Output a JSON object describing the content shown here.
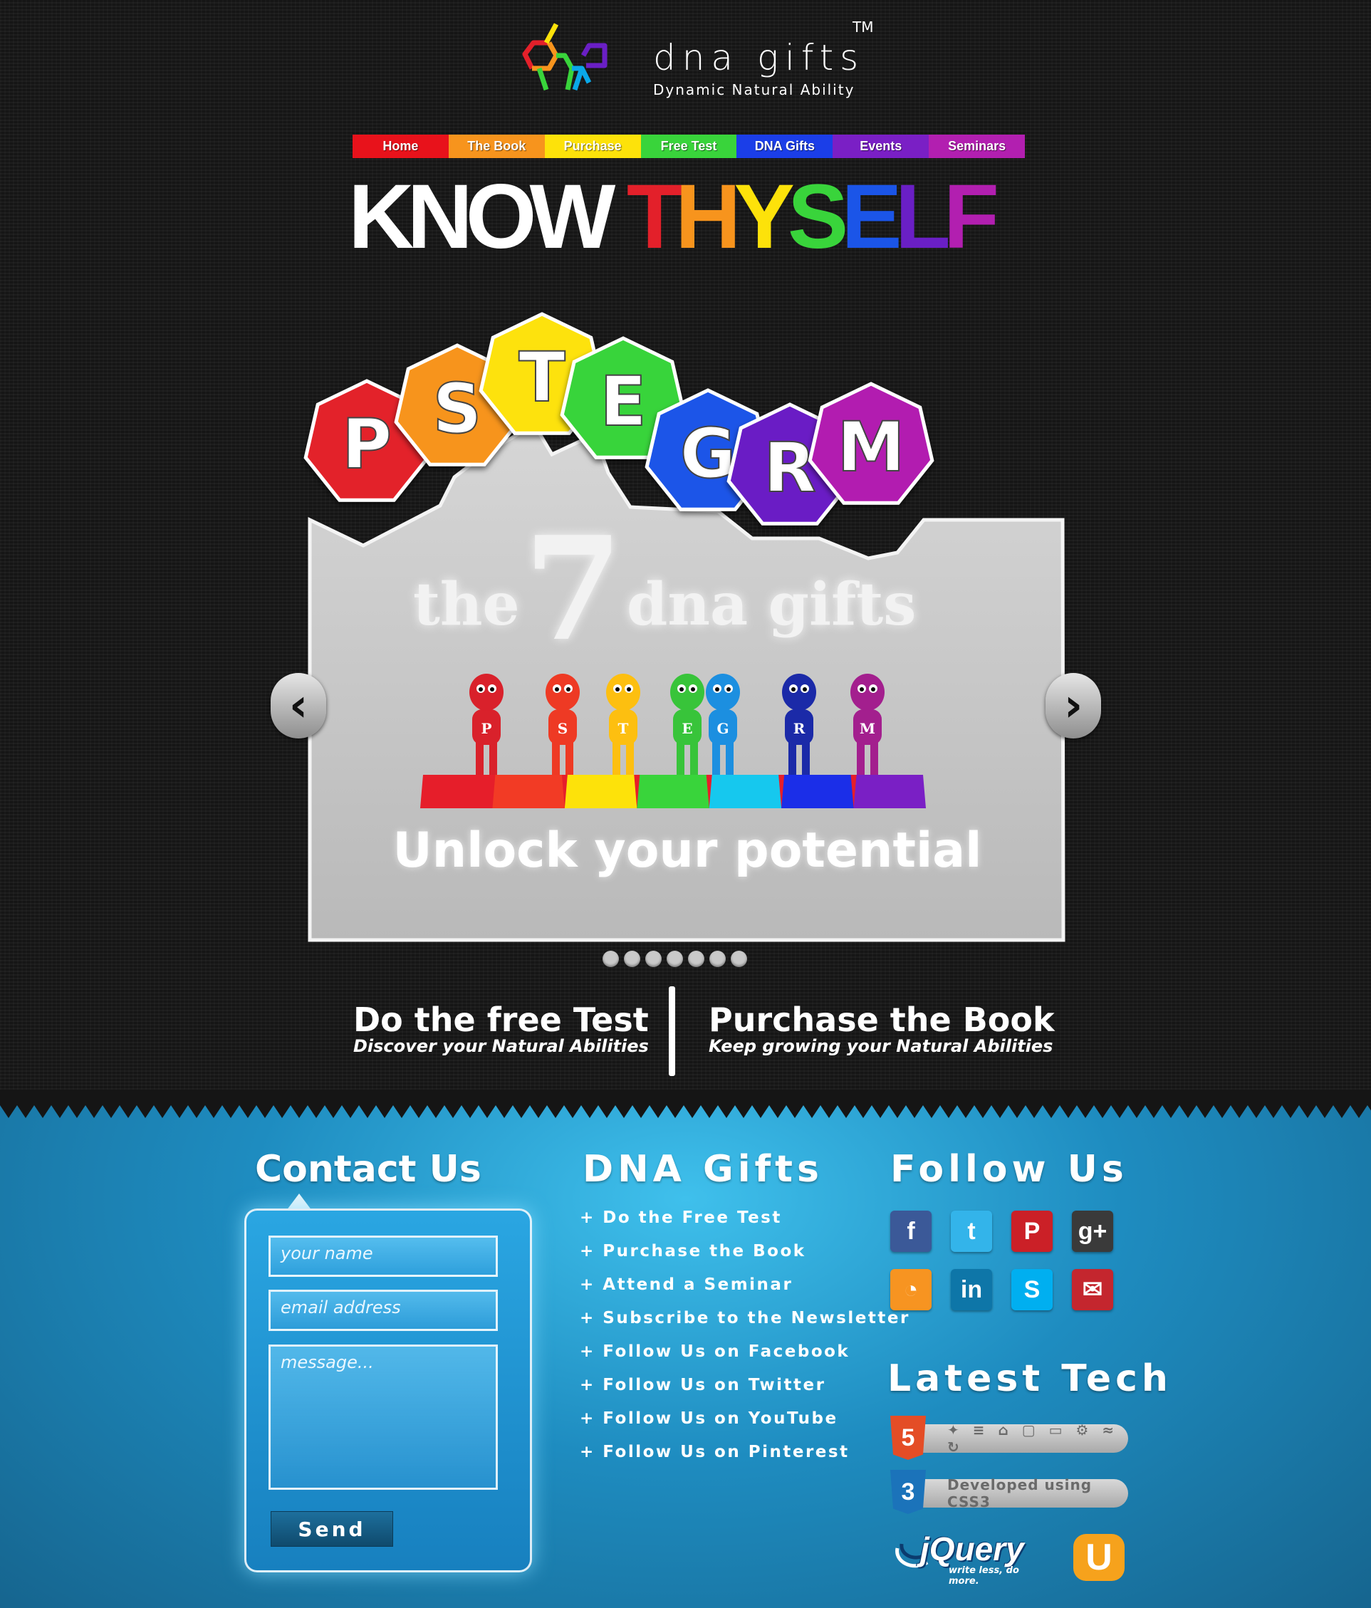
{
  "logo": {
    "name": "dna gifts",
    "tagline": "Dynamic Natural Ability",
    "trademark": "TM"
  },
  "nav": [
    {
      "label": "Home",
      "color": "#e8121b"
    },
    {
      "label": "The Book",
      "color": "#f7941d"
    },
    {
      "label": "Purchase",
      "color": "#fde20a"
    },
    {
      "label": "Free Test",
      "color": "#39d43b"
    },
    {
      "label": "DNA Gifts",
      "color": "#1b3ee8"
    },
    {
      "label": "Events",
      "color": "#7a1fc5"
    },
    {
      "label": "Seminars",
      "color": "#b21fb0"
    }
  ],
  "headline": {
    "part1": "KNOW",
    "part2": "THYSELF"
  },
  "gifts": [
    {
      "letter": "P",
      "color": "#e3202a"
    },
    {
      "letter": "S",
      "color": "#f7941d"
    },
    {
      "letter": "T",
      "color": "#fde20a"
    },
    {
      "letter": "E",
      "color": "#39d43b"
    },
    {
      "letter": "G",
      "color": "#1b55e8"
    },
    {
      "letter": "R",
      "color": "#6a1fc5"
    },
    {
      "letter": "M",
      "color": "#b21fb0"
    }
  ],
  "slide": {
    "title_pre": "the",
    "title_num": "7",
    "title_post": "dna gifts",
    "tagline": "Unlock your potential",
    "figure_letters": [
      "P",
      "S",
      "T",
      "E",
      "G",
      "R",
      "M"
    ],
    "slide_count": 7
  },
  "cta": {
    "test": {
      "title": "Do the free Test",
      "subtitle": "Discover your Natural Abilities"
    },
    "book": {
      "title": "Purchase the Book",
      "subtitle": "Keep growing your Natural Abilities"
    }
  },
  "contact": {
    "heading": "Contact Us",
    "name_placeholder": "your name",
    "email_placeholder": "email address",
    "message_placeholder": "message...",
    "send_label": "Send"
  },
  "dna_links": {
    "heading": "DNA Gifts",
    "items": [
      "+ Do the Free Test",
      "+ Purchase the Book",
      "+ Attend a Seminar",
      "+ Subscribe to the Newsletter",
      "+ Follow Us on Facebook",
      "+ Follow Us on Twitter",
      "+ Follow Us on YouTube",
      "+ Follow Us on Pinterest"
    ]
  },
  "follow": {
    "heading": "Follow Us",
    "icons": [
      {
        "name": "facebook-icon",
        "glyph": "f",
        "color": "#3b5998"
      },
      {
        "name": "twitter-icon",
        "glyph": "t",
        "color": "#33b4ea"
      },
      {
        "name": "pinterest-icon",
        "glyph": "P",
        "color": "#cb2027"
      },
      {
        "name": "googleplus-icon",
        "glyph": "g+",
        "color": "#3a3a3a"
      },
      {
        "name": "rss-icon",
        "glyph": "◔",
        "color": "#f79421"
      },
      {
        "name": "linkedin-icon",
        "glyph": "in",
        "color": "#0e76a8"
      },
      {
        "name": "skype-icon",
        "glyph": "S",
        "color": "#00aff0"
      },
      {
        "name": "email-icon",
        "glyph": "✉",
        "color": "#c4262e"
      }
    ]
  },
  "tech": {
    "heading": "Latest Tech",
    "html5": {
      "badge": "5",
      "icons": "✦ ≡ ⌂ ▢ ▭ ⚙ ≈ ↻"
    },
    "css3": {
      "badge": "3",
      "label": "Developed using CSS3"
    },
    "jquery": {
      "name": "jQuery",
      "tagline": "write less, do more."
    },
    "ubuntu_badge": "U"
  }
}
